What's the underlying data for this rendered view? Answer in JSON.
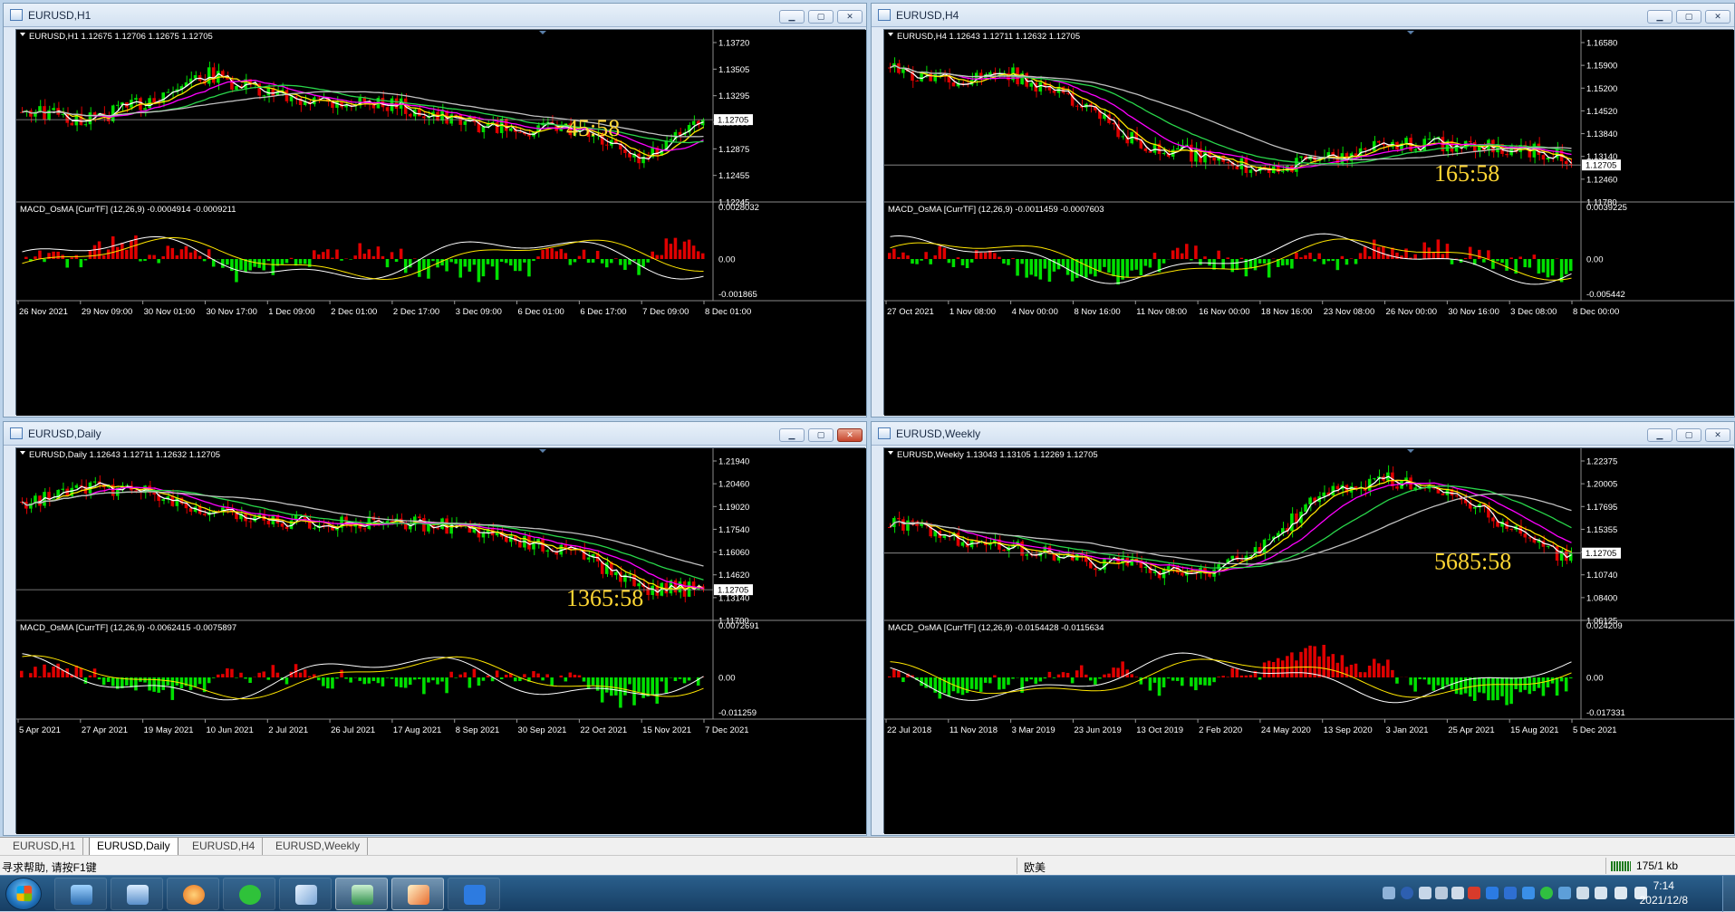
{
  "windows": [
    {
      "id": "h1",
      "title": "EURUSD,H1",
      "header": "EURUSD,H1  1.12675 1.12706 1.12675 1.12705",
      "countdown": "45:58",
      "price_label": "1.12705",
      "price_ticks": [
        "1.13720",
        "1.13505",
        "1.13295",
        "1.13085",
        "1.12875",
        "1.12455",
        "1.12245"
      ],
      "macd_header": "MACD_OsMA [CurrTF] (12,26,9) -0.0004914 -0.0009211",
      "macd_ticks": [
        "0.0028032",
        "0.00",
        "-0.001865"
      ],
      "time_ticks": [
        "26 Nov 2021",
        "29 Nov 09:00",
        "30 Nov 01:00",
        "30 Nov 17:00",
        "1 Dec 09:00",
        "2 Dec 01:00",
        "2 Dec 17:00",
        "3 Dec 09:00",
        "6 Dec 01:00",
        "6 Dec 17:00",
        "7 Dec 09:00",
        "8 Dec 01:00"
      ],
      "close_style": "normal"
    },
    {
      "id": "h4",
      "title": "EURUSD,H4",
      "header": "EURUSD,H4  1.12643 1.12711 1.12632 1.12705",
      "countdown": "165:58",
      "price_label": "1.12705",
      "price_ticks": [
        "1.16580",
        "1.15900",
        "1.15200",
        "1.14520",
        "1.13840",
        "1.13140",
        "1.12460",
        "1.11780"
      ],
      "macd_header": "MACD_OsMA [CurrTF] (12,26,9) -0.0011459 -0.0007603",
      "macd_ticks": [
        "0.0039225",
        "0.00",
        "-0.005442"
      ],
      "time_ticks": [
        "27 Oct 2021",
        "1 Nov 08:00",
        "4 Nov 00:00",
        "8 Nov 16:00",
        "11 Nov 08:00",
        "16 Nov 00:00",
        "18 Nov 16:00",
        "23 Nov 08:00",
        "26 Nov 00:00",
        "30 Nov 16:00",
        "3 Dec 08:00",
        "8 Dec 00:00"
      ],
      "close_style": "normal"
    },
    {
      "id": "daily",
      "title": "EURUSD,Daily",
      "header": "EURUSD,Daily  1.12643 1.12711 1.12632 1.12705",
      "countdown": "1365:58",
      "price_label": "1.12705",
      "price_ticks": [
        "1.21940",
        "1.20460",
        "1.19020",
        "1.17540",
        "1.16060",
        "1.14620",
        "1.13140",
        "1.11700"
      ],
      "macd_header": "MACD_OsMA [CurrTF] (12,26,9) -0.0062415 -0.0075897",
      "macd_ticks": [
        "0.0072691",
        "0.00",
        "-0.011259"
      ],
      "time_ticks": [
        "5 Apr 2021",
        "27 Apr 2021",
        "19 May 2021",
        "10 Jun 2021",
        "2 Jul 2021",
        "26 Jul 2021",
        "17 Aug 2021",
        "8 Sep 2021",
        "30 Sep 2021",
        "22 Oct 2021",
        "15 Nov 2021",
        "7 Dec 2021"
      ],
      "close_style": "red"
    },
    {
      "id": "weekly",
      "title": "EURUSD,Weekly",
      "header": "EURUSD,Weekly  1.13043 1.13105 1.12269 1.12705",
      "countdown": "5685:58",
      "price_label": "1.12705",
      "price_ticks": [
        "1.22375",
        "1.20005",
        "1.17695",
        "1.15355",
        "1.13015",
        "1.10740",
        "1.08400",
        "1.06125"
      ],
      "macd_header": "MACD_OsMA [CurrTF] (12,26,9) -0.0154428 -0.0115634",
      "macd_ticks": [
        "0.024209",
        "0.00",
        "-0.017331"
      ],
      "time_ticks": [
        "22 Jul 2018",
        "11 Nov 2018",
        "3 Mar 2019",
        "23 Jun 2019",
        "13 Oct 2019",
        "2 Feb 2020",
        "24 May 2020",
        "13 Sep 2020",
        "3 Jan 2021",
        "25 Apr 2021",
        "15 Aug 2021",
        "5 Dec 2021"
      ],
      "close_style": "normal"
    }
  ],
  "tabs": [
    {
      "label": "EURUSD,H1",
      "active": false
    },
    {
      "label": "EURUSD,Daily",
      "active": true
    },
    {
      "label": "EURUSD,H4",
      "active": false
    },
    {
      "label": "EURUSD,Weekly",
      "active": false
    }
  ],
  "status": {
    "help": "寻求帮助, 请按F1键",
    "profile": "欧美",
    "traffic": "175/1 kb"
  },
  "clock": {
    "time": "7:14",
    "date": "2021/12/8"
  },
  "colors": {
    "bull": "#00e000",
    "bear": "#e00000",
    "text": "#ffffff",
    "countdown": "#ffd633",
    "ma_white": "#ffffff",
    "ma_yellow": "#ffe600",
    "ma_magenta": "#ff00ff",
    "ma_green": "#29d64a",
    "ma_gray": "#c0c0c0"
  }
}
